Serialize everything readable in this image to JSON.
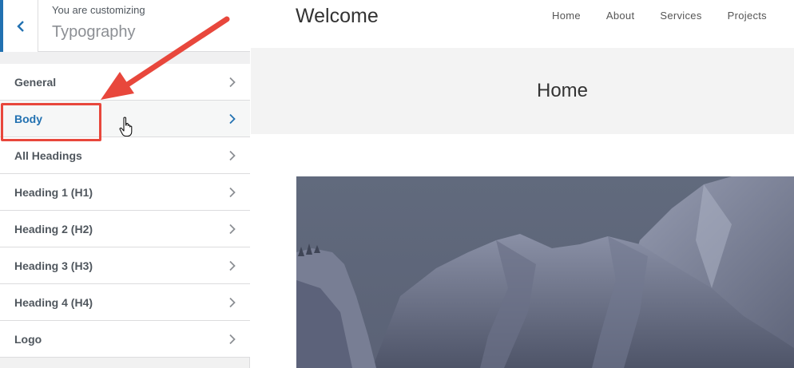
{
  "customizer": {
    "customizing_label": "You are customizing",
    "section_title": "Typography",
    "items": [
      {
        "label": "General"
      },
      {
        "label": "Body"
      },
      {
        "label": "All Headings"
      },
      {
        "label": "Heading 1 (H1)"
      },
      {
        "label": "Heading 2 (H2)"
      },
      {
        "label": "Heading 3 (H3)"
      },
      {
        "label": "Heading 4 (H4)"
      },
      {
        "label": "Logo"
      }
    ],
    "active_item": "Body"
  },
  "preview": {
    "site_title": "Welcome",
    "nav": [
      "Home",
      "About",
      "Services",
      "Projects"
    ],
    "page_title": "Home"
  },
  "colors": {
    "accent": "#2271b1",
    "annotation": "#e8473c"
  },
  "icons": [
    "back-chevron-icon",
    "chevron-right-icon",
    "hand-pointer-icon",
    "annotation-arrow-icon"
  ]
}
